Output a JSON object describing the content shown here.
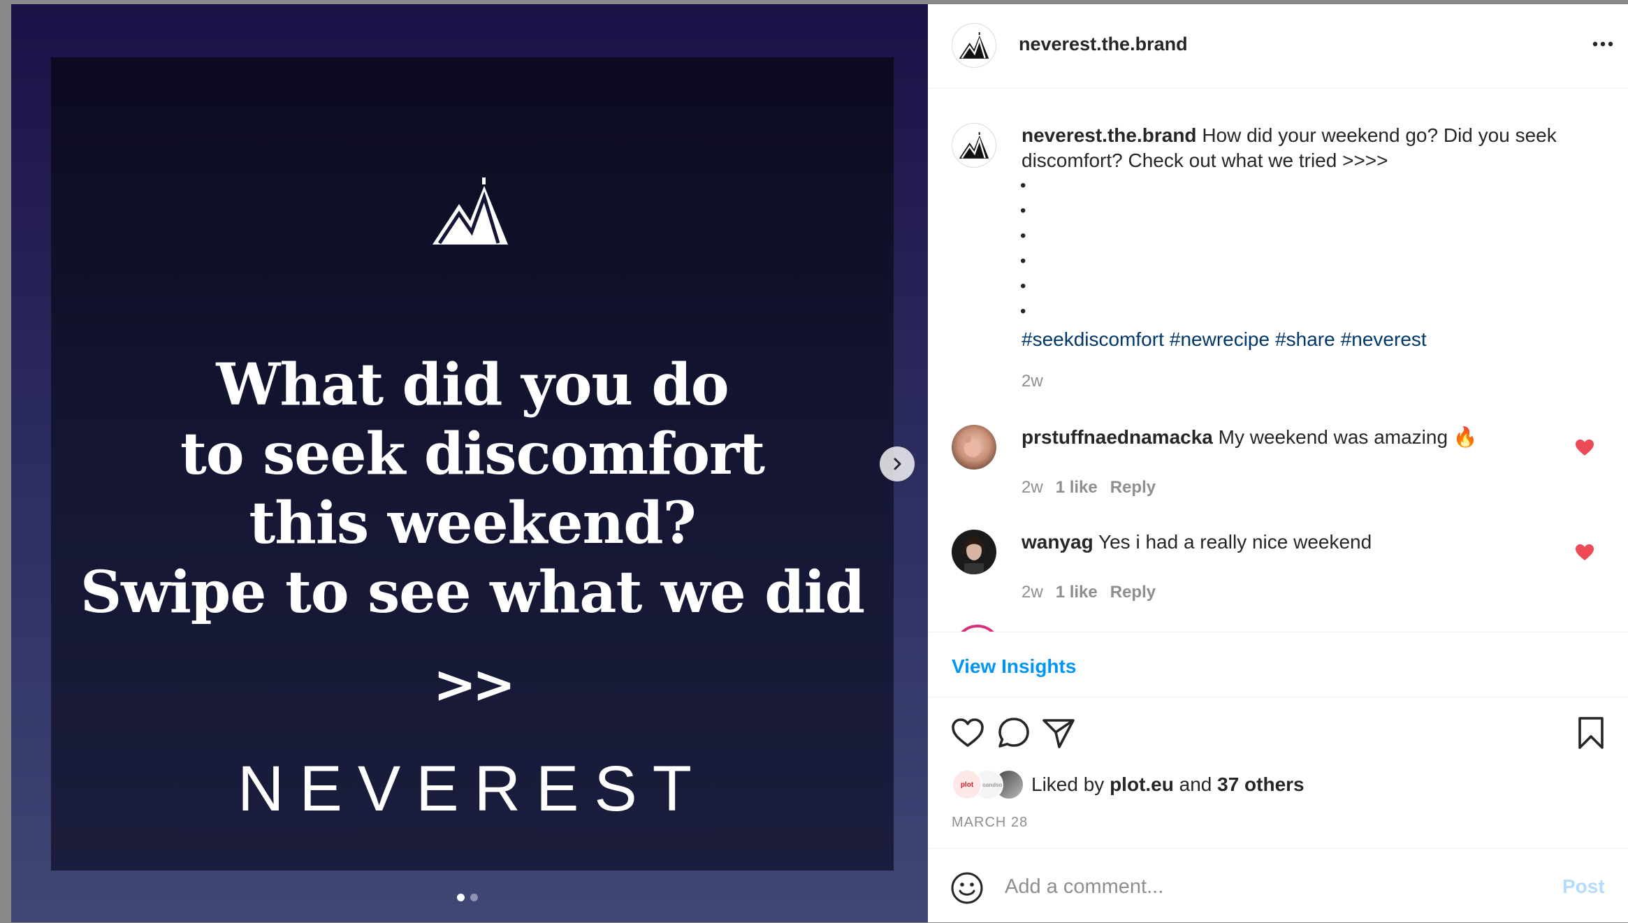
{
  "post": {
    "slide": {
      "headline_lines": [
        "What did you do",
        "to seek discomfort",
        "this weekend?",
        "Swipe to see what we did"
      ],
      "chevrons": ">>",
      "brand_word": "NEVEREST",
      "page_count": 2,
      "active_page": 1
    }
  },
  "header": {
    "username": "neverest.the.brand",
    "more_icon": "more-horizontal-icon"
  },
  "caption": {
    "username": "neverest.the.brand",
    "text": "How did your weekend go? Did you seek discomfort? Check out what we tried >>>>",
    "bullets": [
      "•",
      "•",
      "•",
      "•",
      "•",
      "•"
    ],
    "hashtags": [
      "#seekdiscomfort",
      "#newrecipe",
      "#share",
      "#neverest"
    ],
    "time": "2w"
  },
  "comments": [
    {
      "username": "prstuffnaednamacka",
      "text": "My weekend was amazing 🔥",
      "time": "2w",
      "likes": "1 like",
      "reply": "Reply",
      "liked": true
    },
    {
      "username": "wanyag",
      "text": "Yes i had a really nice weekend",
      "time": "2w",
      "likes": "1 like",
      "reply": "Reply",
      "liked": true
    }
  ],
  "insights": {
    "label": "View Insights"
  },
  "actions": [
    "heart-icon",
    "comment-icon",
    "share-icon",
    "bookmark-icon"
  ],
  "likes": {
    "prefix": "Liked by",
    "user": "plot.eu",
    "conjunction": "and",
    "others": "37 others",
    "liker_avatars": [
      "plot",
      "Heloandso",
      "photo"
    ]
  },
  "date": "MARCH 28",
  "comment_box": {
    "placeholder": "Add a comment...",
    "post_label": "Post"
  },
  "colors": {
    "link_blue": "#0095f6",
    "hashtag": "#00376b",
    "heart_red": "#ed4956",
    "post_disabled": "#b3dbff"
  }
}
